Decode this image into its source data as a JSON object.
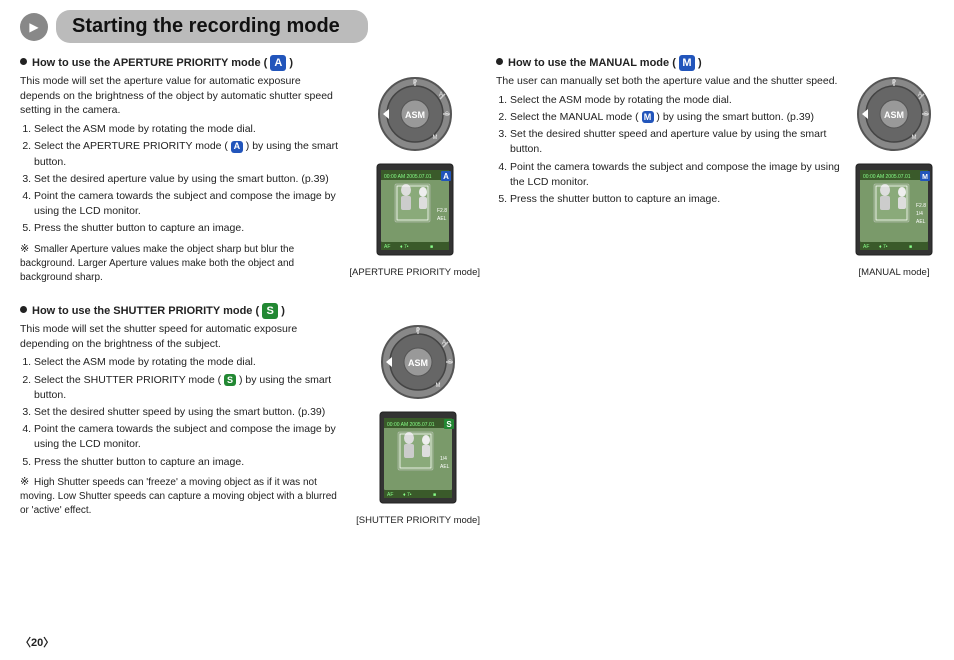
{
  "header": {
    "title": "Starting the recording mode"
  },
  "left_column": {
    "section1": {
      "title_pre": "How to use the APERTURE PRIORITY mode (",
      "title_badge": "A",
      "title_badge_class": "blue",
      "title_post": ")",
      "intro": "This mode will set the aperture value for automatic exposure depends on the brightness of the object by automatic shutter speed setting in the camera.",
      "steps": [
        "Select the ASM mode by rotating the mode dial.",
        "Select the APERTURE PRIORITY mode ( A ) by using the smart button.",
        "Set the desired aperture value by using the smart button. (p.39)",
        "Point the camera towards the subject and compose the image by using the LCD monitor.",
        "Press the shutter button to capture an image."
      ],
      "note": "Smaller Aperture values make the object sharp but blur the background. Larger Aperture values make both the object and background sharp.",
      "caption": "[APERTURE PRIORITY mode]"
    },
    "section2": {
      "title_pre": "How to use the SHUTTER PRIORITY mode (",
      "title_badge": "S",
      "title_badge_class": "green",
      "title_post": ")",
      "intro": "This mode will set the shutter speed for automatic exposure depending on the brightness of the subject.",
      "steps": [
        "Select the ASM mode by rotating the mode dial.",
        "Select the SHUTTER PRIORITY mode ( S ) by using the smart button.",
        "Set the desired shutter speed by using the smart button. (p.39)",
        "Point the camera towards the subject and compose the image by using the LCD monitor.",
        "Press the shutter button to capture an image."
      ],
      "note": "High Shutter speeds can 'freeze' a moving object as if it was not moving. Low Shutter speeds can capture a moving object with a blurred or 'active' effect.",
      "caption": "[SHUTTER PRIORITY mode]"
    }
  },
  "right_column": {
    "section1": {
      "title_pre": "How to use the MANUAL mode (",
      "title_badge": "M",
      "title_badge_class": "blue",
      "title_post": ")",
      "intro": "The user can manually set both the aperture value and the shutter speed.",
      "steps": [
        "Select the ASM mode by rotating the mode dial.",
        "Select the MANUAL mode ( M ) by using the smart button. (p.39)",
        "Set the desired shutter speed and aperture value by using the smart button.",
        "Point the camera towards the subject and compose the image by using the LCD monitor.",
        "Press the shutter button to capture an image."
      ],
      "caption": "[MANUAL mode]"
    }
  },
  "footer": {
    "page_number": "〈20〉"
  }
}
